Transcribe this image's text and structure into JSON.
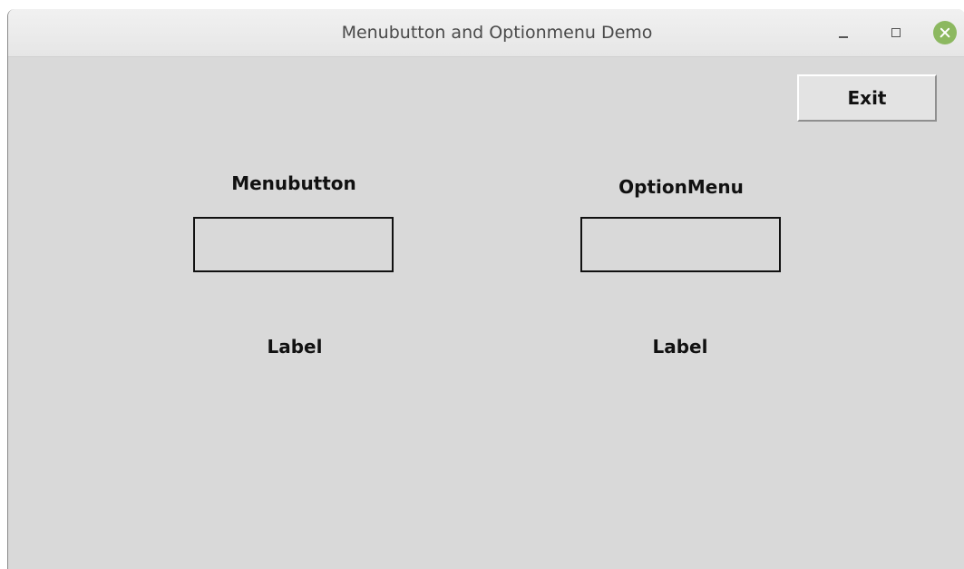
{
  "window": {
    "title": "Menubutton and Optionmenu Demo",
    "controls": [
      "minimize-icon",
      "maximize-icon",
      "close-icon"
    ],
    "close_color": "#8cb860",
    "background": "#d9d9d9"
  },
  "toolbar": {
    "exit_label": "Exit"
  },
  "menubutton_section": {
    "heading": "Menubutton",
    "selected_value": "",
    "label": "Label"
  },
  "optionmenu_section": {
    "heading": "OptionMenu",
    "selected_value": "",
    "label": "Label"
  }
}
